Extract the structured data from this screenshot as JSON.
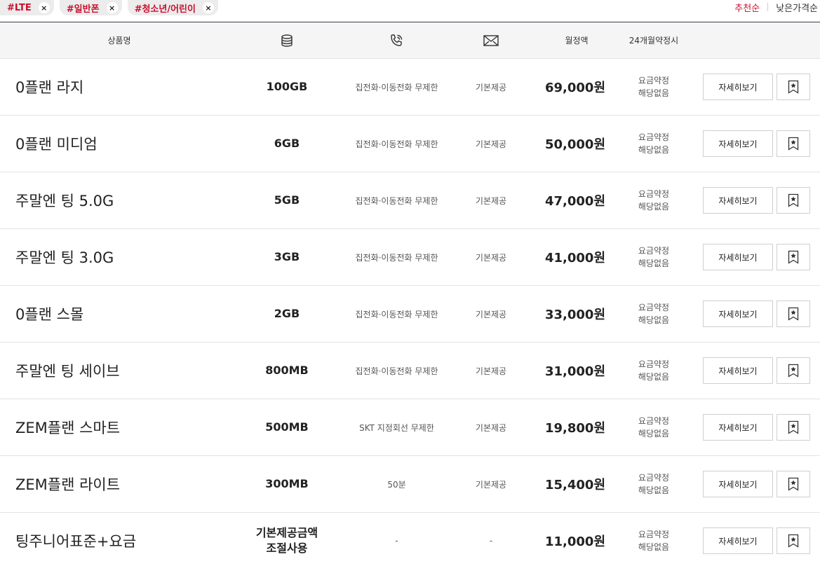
{
  "filters": {
    "tags": [
      {
        "label": "#LTE"
      },
      {
        "label": "#일반폰"
      },
      {
        "label": "#청소년/어린이"
      }
    ],
    "remove_glyph": "×"
  },
  "sort": {
    "recommended": "추천순",
    "low_price": "낮은가격순",
    "active_color": "#c8102e"
  },
  "table": {
    "headers": {
      "name": "상품명",
      "data_icon": "database-icon",
      "call_icon": "phone-call-icon",
      "sms_icon": "envelope-icon",
      "price": "월정액",
      "contract": "24개월약정시"
    },
    "detail_label": "자세히보기",
    "bookmark_icon": "bookmark-star-icon",
    "rows": [
      {
        "name": "0플랜 라지",
        "data": "100GB",
        "call": "집전화·이동전화 무제한",
        "sms": "기본제공",
        "price": "69,000원",
        "contract_line1": "요금약정",
        "contract_line2": "해당없음"
      },
      {
        "name": "0플랜 미디엄",
        "data": "6GB",
        "call": "집전화·이동전화 무제한",
        "sms": "기본제공",
        "price": "50,000원",
        "contract_line1": "요금약정",
        "contract_line2": "해당없음"
      },
      {
        "name": "주말엔 팅 5.0G",
        "data": "5GB",
        "call": "집전화·이동전화 무제한",
        "sms": "기본제공",
        "price": "47,000원",
        "contract_line1": "요금약정",
        "contract_line2": "해당없음"
      },
      {
        "name": "주말엔 팅 3.0G",
        "data": "3GB",
        "call": "집전화·이동전화 무제한",
        "sms": "기본제공",
        "price": "41,000원",
        "contract_line1": "요금약정",
        "contract_line2": "해당없음"
      },
      {
        "name": "0플랜 스몰",
        "data": "2GB",
        "call": "집전화·이동전화 무제한",
        "sms": "기본제공",
        "price": "33,000원",
        "contract_line1": "요금약정",
        "contract_line2": "해당없음"
      },
      {
        "name": "주말엔 팅 세이브",
        "data": "800MB",
        "call": "집전화·이동전화 무제한",
        "sms": "기본제공",
        "price": "31,000원",
        "contract_line1": "요금약정",
        "contract_line2": "해당없음"
      },
      {
        "name": "ZEM플랜 스마트",
        "data": "500MB",
        "call": "SKT 지정회선 무제한",
        "sms": "기본제공",
        "price": "19,800원",
        "contract_line1": "요금약정",
        "contract_line2": "해당없음"
      },
      {
        "name": "ZEM플랜 라이트",
        "data": "300MB",
        "call": "50분",
        "sms": "기본제공",
        "price": "15,400원",
        "contract_line1": "요금약정",
        "contract_line2": "해당없음"
      },
      {
        "name": "팅주니어표준+요금",
        "data": "기본제공금액\n조절사용",
        "call": "-",
        "sms": "-",
        "price": "11,000원",
        "contract_line1": "요금약정",
        "contract_line2": "해당없음"
      }
    ]
  }
}
